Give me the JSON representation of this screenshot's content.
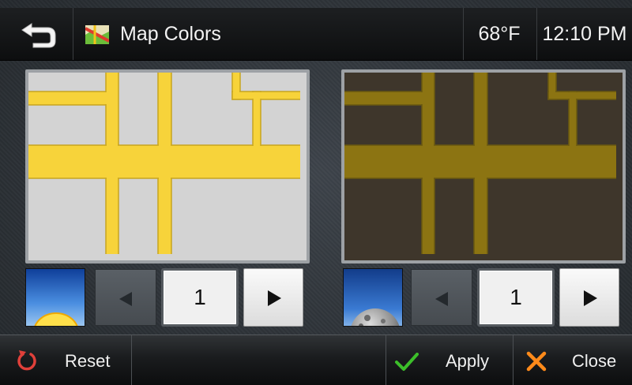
{
  "header": {
    "title": "Map Colors",
    "temperature": "68°F",
    "time": "12:10 PM",
    "back_icon": "back-arrow-icon",
    "app_icon": "map-icon"
  },
  "day_scheme": {
    "mode_icon": "sun-icon",
    "number": "1",
    "colors": {
      "background": "#d3d3d3",
      "road": "#f7d33a",
      "road_edge": "#c7a520"
    }
  },
  "night_scheme": {
    "mode_icon": "moon-icon",
    "number": "1",
    "colors": {
      "background": "#3e362b",
      "road": "#8c7412",
      "road_edge": "#6a5810"
    }
  },
  "footer": {
    "reset_label": "Reset",
    "apply_label": "Apply",
    "close_label": "Close"
  },
  "colors": {
    "apply_check": "#3cbf2a",
    "close_x": "#ff8a1a",
    "reset_icon": "#e0403a"
  }
}
